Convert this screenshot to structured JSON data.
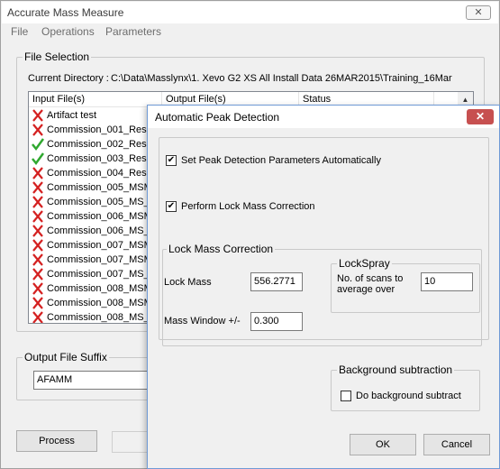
{
  "main": {
    "title": "Accurate Mass Measure",
    "close_symbol": "✕",
    "menu": [
      "File",
      "Operations",
      "Parameters"
    ],
    "file_selection": {
      "label": "File Selection",
      "current_dir_label": "Current Directory :",
      "current_dir_value": "C:\\Data\\Masslynx\\1. Xevo G2 XS All Install Data 26MAR2015\\Training_16Mar",
      "columns": [
        "Input File(s)",
        "Output File(s)",
        "Status"
      ],
      "rows": [
        {
          "name": "Artifact test",
          "status_icon": "x-icon"
        },
        {
          "name": "Commission_001_Resol",
          "status_icon": "x-icon"
        },
        {
          "name": "Commission_002_Resol",
          "status_icon": "check-icon"
        },
        {
          "name": "Commission_003_Resol",
          "status_icon": "check-icon"
        },
        {
          "name": "Commission_004_Resol",
          "status_icon": "x-icon"
        },
        {
          "name": "Commission_005_MSMS",
          "status_icon": "x-icon"
        },
        {
          "name": "Commission_005_MS_F",
          "status_icon": "x-icon"
        },
        {
          "name": "Commission_006_MSMS",
          "status_icon": "x-icon"
        },
        {
          "name": "Commission_006_MS_F",
          "status_icon": "x-icon"
        },
        {
          "name": "Commission_007_MSMS",
          "status_icon": "x-icon"
        },
        {
          "name": "Commission_007_MSMS",
          "status_icon": "x-icon"
        },
        {
          "name": "Commission_007_MS_F",
          "status_icon": "x-icon"
        },
        {
          "name": "Commission_008_MSMS",
          "status_icon": "x-icon"
        },
        {
          "name": "Commission_008_MSMS",
          "status_icon": "x-icon"
        },
        {
          "name": "Commission_008_MS_F",
          "status_icon": "x-icon"
        }
      ]
    },
    "output_suffix": {
      "label": "Output File Suffix",
      "value": "AFAMM"
    },
    "process_label": "Process"
  },
  "dialog": {
    "title": "Automatic Peak Detection",
    "close_symbol": "✕",
    "check_auto_label": "Set Peak Detection Parameters Automatically",
    "check_auto": true,
    "check_lock_label": "Perform Lock Mass Correction",
    "check_lock": true,
    "lock_mass_group": "Lock Mass Correction",
    "lock_mass_label": "Lock Mass",
    "lock_mass_value": "556.2771",
    "mass_window_label": "Mass Window +/-",
    "mass_window_value": "0.300",
    "lockspray_group": "LockSpray",
    "scans_label_1": "No. of scans to",
    "scans_label_2": "average over",
    "scans_value": "10",
    "bg_group": "Background subtraction",
    "bg_check_label": "Do background subtract",
    "bg_check": false,
    "ok_label": "OK",
    "cancel_label": "Cancel"
  },
  "colors": {
    "x": "#d42020",
    "check": "#2fa82f",
    "dialog_border": "#6f9ad6"
  }
}
